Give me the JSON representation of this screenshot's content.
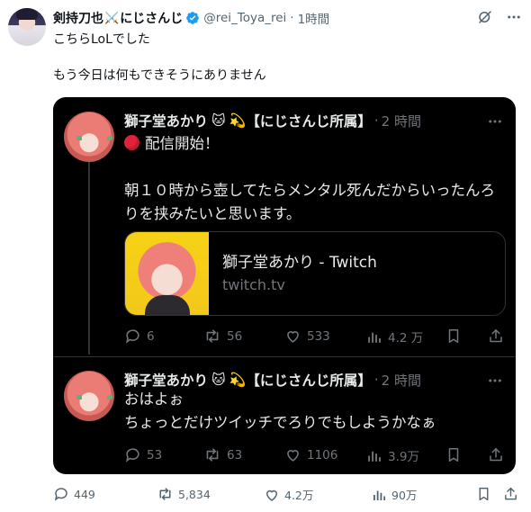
{
  "tweet": {
    "display_name": "剣持刀也",
    "name_emoji": "⚔️",
    "name_suffix": "にじさんじ",
    "handle": "@rei_Toya_rei",
    "separator": "·",
    "time": "1時間",
    "text_line1": "こちらLoLでした",
    "text_line2": "もう今日は何もできそうにありません",
    "verified_color": "#1d9bf0",
    "actions": {
      "replies": "449",
      "reposts": "5,834",
      "likes": "4.2万",
      "views": "90万"
    }
  },
  "quote": {
    "posts": [
      {
        "display_name": "獅子堂あかり",
        "emoji1": "🐱",
        "emoji2": "💫",
        "name_suffix": "【にじさんじ所属】",
        "separator": "·",
        "time": "2 時間",
        "live_text": "配信開始！",
        "text": "朝１０時から壺してたらメンタル死んだからいったんろりを挟みたいと思います。",
        "link_card": {
          "title": "獅子堂あかり - Twitch",
          "domain": "twitch.tv"
        },
        "actions": {
          "replies": "6",
          "reposts": "56",
          "likes": "533",
          "views": "4.2 万"
        }
      },
      {
        "display_name": "獅子堂あかり",
        "emoji1": "🐱",
        "emoji2": "💫",
        "name_suffix": "【にじさんじ所属】",
        "separator": "·",
        "time": "2 時間",
        "text_line1": "おはよぉ",
        "text_line2": "ちょっとだけツイッチでろりでもしようかなぁ",
        "actions": {
          "replies": "53",
          "reposts": "63",
          "likes": "1106",
          "views": "3.9万"
        }
      }
    ],
    "background": "#000000"
  },
  "icons": [
    "grok-icon",
    "more-icon",
    "reply-icon",
    "repost-icon",
    "like-icon",
    "views-icon",
    "bookmark-icon",
    "share-icon",
    "verified-icon"
  ]
}
